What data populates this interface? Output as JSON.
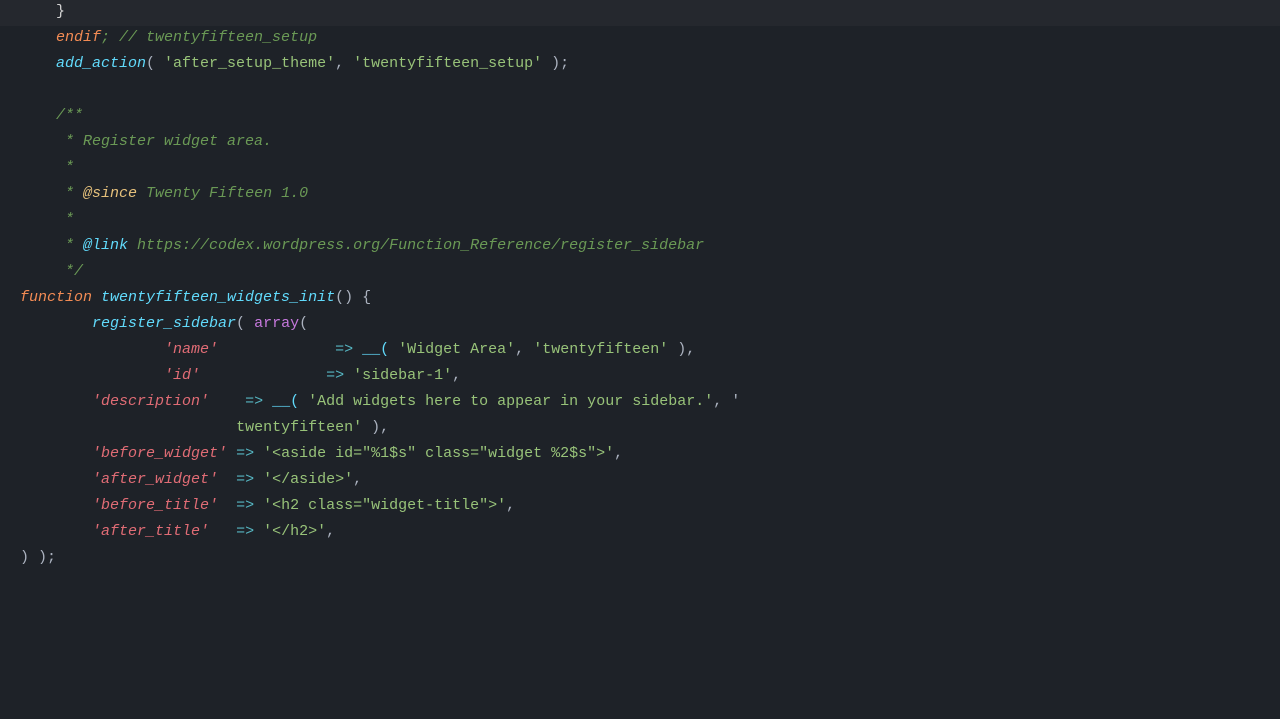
{
  "code": {
    "lines": [
      {
        "indent": "    ",
        "tokens": [
          {
            "text": "}",
            "class": "c-default"
          }
        ]
      },
      {
        "indent": "    ",
        "tokens": [
          {
            "text": "endif",
            "class": "c-keyword"
          },
          {
            "text": "; // twentyfifteen_setup",
            "class": "c-comment"
          }
        ]
      },
      {
        "indent": "    ",
        "tokens": [
          {
            "text": "add_action",
            "class": "c-function"
          },
          {
            "text": "( ",
            "class": "c-plain"
          },
          {
            "text": "'after_setup_theme'",
            "class": "c-string"
          },
          {
            "text": ", ",
            "class": "c-plain"
          },
          {
            "text": "'twentyfifteen_setup'",
            "class": "c-string"
          },
          {
            "text": " );",
            "class": "c-plain"
          }
        ]
      },
      {
        "indent": "",
        "tokens": []
      },
      {
        "indent": "    ",
        "tokens": [
          {
            "text": "/**",
            "class": "c-comment"
          }
        ]
      },
      {
        "indent": "    ",
        "tokens": [
          {
            "text": " * Register widget area.",
            "class": "c-comment"
          }
        ]
      },
      {
        "indent": "    ",
        "tokens": [
          {
            "text": " *",
            "class": "c-comment"
          }
        ]
      },
      {
        "indent": "    ",
        "tokens": [
          {
            "text": " * ",
            "class": "c-comment"
          },
          {
            "text": "@since",
            "class": "c-since-kw"
          },
          {
            "text": " Twenty Fifteen 1.0",
            "class": "c-since-val"
          }
        ]
      },
      {
        "indent": "    ",
        "tokens": [
          {
            "text": " *",
            "class": "c-comment"
          }
        ]
      },
      {
        "indent": "    ",
        "tokens": [
          {
            "text": " * ",
            "class": "c-comment"
          },
          {
            "text": "@link",
            "class": "c-link-kw"
          },
          {
            "text": " https://codex.wordpress.org/Function_Reference/register_sidebar",
            "class": "c-url"
          }
        ]
      },
      {
        "indent": "    ",
        "tokens": [
          {
            "text": " */",
            "class": "c-comment"
          }
        ]
      },
      {
        "indent": "",
        "tokens": [
          {
            "text": "function",
            "class": "c-keyword"
          },
          {
            "text": " ",
            "class": "c-plain"
          },
          {
            "text": "twentyfifteen_widgets_init",
            "class": "c-function"
          },
          {
            "text": "()",
            "class": "c-plain"
          },
          {
            "text": " {",
            "class": "c-plain"
          }
        ]
      },
      {
        "indent": "    ",
        "tokens": [
          {
            "text": "    register_sidebar",
            "class": "c-function"
          },
          {
            "text": "( ",
            "class": "c-plain"
          },
          {
            "text": "array",
            "class": "c-array-kw"
          },
          {
            "text": "(",
            "class": "c-plain"
          }
        ]
      },
      {
        "indent": "        ",
        "tokens": [
          {
            "text": "        ",
            "class": "c-plain"
          },
          {
            "text": "'name'",
            "class": "c-param-key"
          },
          {
            "text": "             ",
            "class": "c-plain"
          },
          {
            "text": "=>",
            "class": "c-arrow"
          },
          {
            "text": " ",
            "class": "c-plain"
          },
          {
            "text": "__(",
            "class": "c-dunder"
          },
          {
            "text": " ",
            "class": "c-plain"
          },
          {
            "text": "'Widget Area'",
            "class": "c-string"
          },
          {
            "text": ", ",
            "class": "c-plain"
          },
          {
            "text": "'twentyfifteen'",
            "class": "c-string"
          },
          {
            "text": " ),",
            "class": "c-plain"
          }
        ]
      },
      {
        "indent": "        ",
        "tokens": [
          {
            "text": "        ",
            "class": "c-plain"
          },
          {
            "text": "'id'",
            "class": "c-param-key"
          },
          {
            "text": "              ",
            "class": "c-plain"
          },
          {
            "text": "=>",
            "class": "c-arrow"
          },
          {
            "text": " ",
            "class": "c-plain"
          },
          {
            "text": "'sidebar-1'",
            "class": "c-string"
          },
          {
            "text": ",",
            "class": "c-plain"
          }
        ]
      },
      {
        "indent": "    ",
        "tokens": [
          {
            "text": "    ",
            "class": "c-plain"
          },
          {
            "text": "'description'",
            "class": "c-param-key"
          },
          {
            "text": "    ",
            "class": "c-plain"
          },
          {
            "text": "=>",
            "class": "c-arrow"
          },
          {
            "text": " ",
            "class": "c-plain"
          },
          {
            "text": "__(",
            "class": "c-dunder"
          },
          {
            "text": " ",
            "class": "c-plain"
          },
          {
            "text": "'Add widgets here to appear in your sidebar.'",
            "class": "c-string"
          },
          {
            "text": ", '",
            "class": "c-plain"
          }
        ]
      },
      {
        "indent": "            ",
        "tokens": [
          {
            "text": "            ",
            "class": "c-plain"
          },
          {
            "text": "twentyfifteen'",
            "class": "c-string"
          },
          {
            "text": " ),",
            "class": "c-plain"
          }
        ]
      },
      {
        "indent": "    ",
        "tokens": [
          {
            "text": "    ",
            "class": "c-plain"
          },
          {
            "text": "'before_widget'",
            "class": "c-param-key"
          },
          {
            "text": " ",
            "class": "c-plain"
          },
          {
            "text": "=>",
            "class": "c-arrow"
          },
          {
            "text": " ",
            "class": "c-plain"
          },
          {
            "text": "'<aside id=\"%1$s\" class=\"widget %2$s\">'",
            "class": "c-string"
          },
          {
            "text": ",",
            "class": "c-plain"
          }
        ]
      },
      {
        "indent": "    ",
        "tokens": [
          {
            "text": "    ",
            "class": "c-plain"
          },
          {
            "text": "'after_widget'",
            "class": "c-param-key"
          },
          {
            "text": "  ",
            "class": "c-plain"
          },
          {
            "text": "=>",
            "class": "c-arrow"
          },
          {
            "text": " ",
            "class": "c-plain"
          },
          {
            "text": "'</aside>'",
            "class": "c-string"
          },
          {
            "text": ",",
            "class": "c-plain"
          }
        ]
      },
      {
        "indent": "    ",
        "tokens": [
          {
            "text": "    ",
            "class": "c-plain"
          },
          {
            "text": "'before_title'",
            "class": "c-param-key"
          },
          {
            "text": "  ",
            "class": "c-plain"
          },
          {
            "text": "=>",
            "class": "c-arrow"
          },
          {
            "text": " ",
            "class": "c-plain"
          },
          {
            "text": "'<h2 class=\"widget-title\">'",
            "class": "c-string"
          },
          {
            "text": ",",
            "class": "c-plain"
          }
        ]
      },
      {
        "indent": "    ",
        "tokens": [
          {
            "text": "    ",
            "class": "c-plain"
          },
          {
            "text": "'after_title'",
            "class": "c-param-key"
          },
          {
            "text": "   ",
            "class": "c-plain"
          },
          {
            "text": "=>",
            "class": "c-arrow"
          },
          {
            "text": " ",
            "class": "c-plain"
          },
          {
            "text": "'</h2>'",
            "class": "c-string"
          },
          {
            "text": ",",
            "class": "c-plain"
          }
        ]
      },
      {
        "indent": "",
        "tokens": [
          {
            "text": ") );",
            "class": "c-plain"
          }
        ]
      }
    ]
  }
}
